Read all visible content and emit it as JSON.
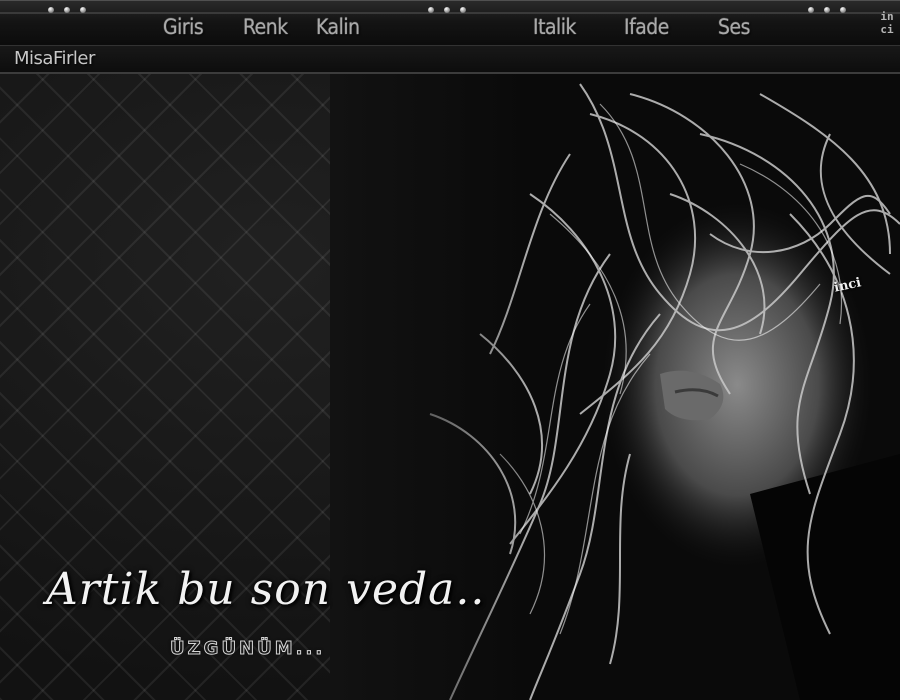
{
  "nav": {
    "items": [
      {
        "label": "Giris"
      },
      {
        "label": "Renk"
      },
      {
        "label": "Kalin"
      },
      {
        "label": "Italik"
      },
      {
        "label": "Ifade"
      },
      {
        "label": "Ses"
      }
    ]
  },
  "sidebar": {
    "guests_label": "MisaFirler"
  },
  "brand": {
    "vertical_text": "inci"
  },
  "banner": {
    "title": "Artik bu son veda..",
    "subtitle": "ÜZGÜNÜM...",
    "signature": "inci"
  },
  "colors": {
    "background": "#0c0c0c",
    "text": "#a9a9a9",
    "accent": "#ffffff"
  }
}
